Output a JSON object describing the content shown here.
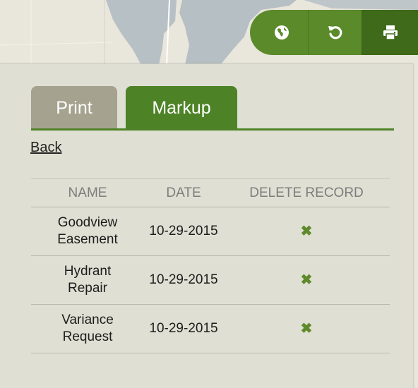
{
  "toolbar": {
    "buttons": [
      {
        "icon": "globe-icon"
      },
      {
        "icon": "refresh-icon"
      },
      {
        "icon": "print-icon"
      }
    ],
    "accent": "#5a8a2a",
    "active": "#3e6a1a"
  },
  "panel": {
    "tabs": [
      {
        "label": "Print",
        "active": false
      },
      {
        "label": "Markup",
        "active": true
      }
    ],
    "back_label": "Back",
    "table": {
      "headers": [
        "NAME",
        "DATE",
        "DELETE RECORD"
      ],
      "rows": [
        {
          "name_line1": "Goodview",
          "name_line2": "Easement",
          "date": "10-29-2015",
          "delete_icon": "delete-x-icon"
        },
        {
          "name_line1": "Hydrant",
          "name_line2": "Repair",
          "date": "10-29-2015",
          "delete_icon": "delete-x-icon"
        },
        {
          "name_line1": "Variance",
          "name_line2": "Request",
          "date": "10-29-2015",
          "delete_icon": "delete-x-icon"
        }
      ]
    }
  },
  "colors": {
    "tab_active": "#4d8326",
    "tab_inactive": "#a5a38f",
    "panel_bg": "#dfdfd3"
  }
}
